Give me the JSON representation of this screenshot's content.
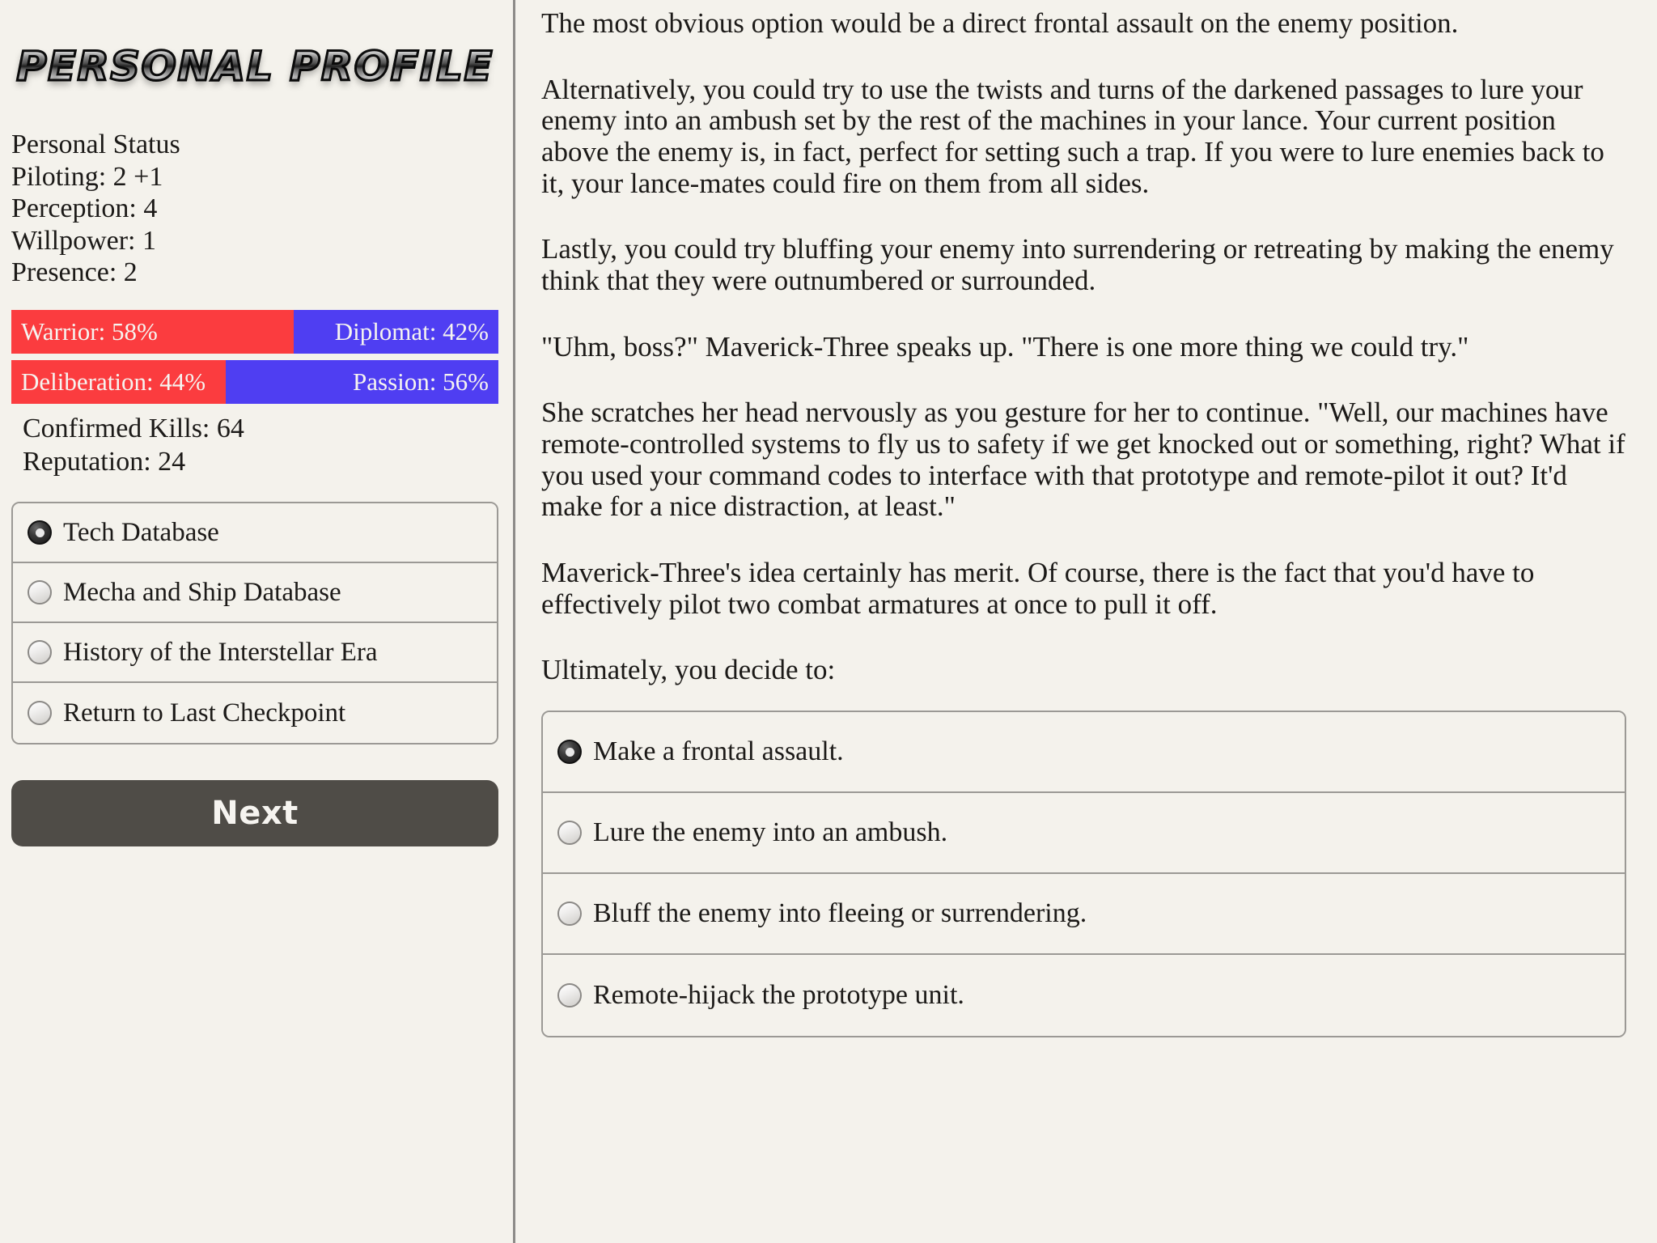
{
  "sidebar": {
    "logo_title": "Personal Profile",
    "status_heading": "Personal Status",
    "stats": [
      "Piloting: 2 +1",
      "Perception: 4",
      "Willpower: 1",
      "Presence: 2"
    ],
    "bars": [
      {
        "left_label": "Warrior: 58%",
        "left_value": 58,
        "right_label": "Diplomat: 42%",
        "right_value": 42,
        "left_color": "#fb3c3f",
        "right_color": "#4f3ef2"
      },
      {
        "left_label": "Deliberation: 44%",
        "left_value": 44,
        "right_label": "Passion: 56%",
        "right_value": 56,
        "left_color": "#fb3c3f",
        "right_color": "#4f3ef2"
      }
    ],
    "counts": [
      "Confirmed Kills: 64",
      "Reputation: 24"
    ],
    "menu_items": [
      {
        "label": "Tech Database",
        "selected": true
      },
      {
        "label": "Mecha and Ship Database",
        "selected": false
      },
      {
        "label": "History of the Interstellar Era",
        "selected": false
      },
      {
        "label": "Return to Last Checkpoint",
        "selected": false
      }
    ],
    "next_label": "Next"
  },
  "main": {
    "paragraphs": [
      "The most obvious option would be a direct frontal assault on the enemy position.",
      "Alternatively, you could try to use the twists and turns of the darkened passages to lure your enemy into an ambush set by the rest of the machines in your lance. Your current position above the enemy is, in fact, perfect for setting such a trap. If you were to lure enemies back to it, your lance-mates could fire on them from all sides.",
      "Lastly, you could try bluffing your enemy into surrendering or retreating by making the enemy think that they were outnumbered or surrounded.",
      "\"Uhm, boss?\" Maverick-Three speaks up. \"There is one more thing we could try.\"",
      "She scratches her head nervously as you gesture for her to continue. \"Well, our machines have remote-controlled systems to fly us to safety if we get knocked out or something, right? What if you used your command codes to interface with that prototype and remote-pilot it out? It'd make for a nice distraction, at least.\"",
      "Maverick-Three's idea certainly has merit. Of course, there is the fact that you'd have to effectively pilot two combat armatures at once to pull it off.",
      "Ultimately, you decide to:"
    ],
    "choices": [
      {
        "label": "Make a frontal assault.",
        "selected": true
      },
      {
        "label": "Lure the enemy into an ambush.",
        "selected": false
      },
      {
        "label": "Bluff the enemy into fleeing or surrendering.",
        "selected": false
      },
      {
        "label": "Remote-hijack the prototype unit.",
        "selected": false
      }
    ]
  }
}
